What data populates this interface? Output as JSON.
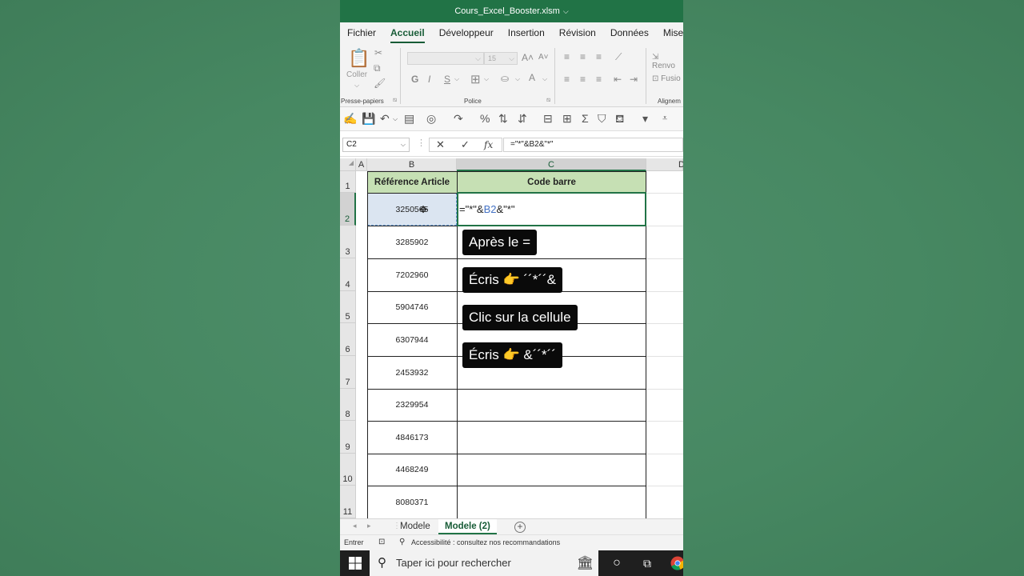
{
  "window": {
    "title": "Cours_Excel_Booster.xlsm"
  },
  "menu": {
    "tabs": [
      "Fichier",
      "Accueil",
      "Développeur",
      "Insertion",
      "Révision",
      "Données",
      "Mise en"
    ]
  },
  "ribbon": {
    "paste_label": "Coller",
    "font_size": "15",
    "bold": "G",
    "italic": "I",
    "underline": "S",
    "groups": {
      "clipboard": "Presse-papiers",
      "font": "Police",
      "alignment": "Alignem"
    },
    "wrap_label": "Renvo",
    "merge_label": "Fusio"
  },
  "formula_bar": {
    "name_box": "C2",
    "cancel": "✕",
    "enter": "✓",
    "fx": "fx",
    "formula": "=\"*\"&B2&\"*\""
  },
  "grid": {
    "columns": [
      "A",
      "B",
      "C",
      "D"
    ],
    "rows": [
      "1",
      "2",
      "3",
      "4",
      "5",
      "6",
      "7",
      "8",
      "9",
      "10",
      "11"
    ],
    "header_b": "Référence Article",
    "header_c": "Code barre",
    "b_values": [
      "3250565",
      "3285902",
      "7202960",
      "5904746",
      "6307944",
      "2453932",
      "2329954",
      "4846173",
      "4468249",
      "8080371"
    ],
    "c2_parts": {
      "p1": "=\"*\"&",
      "ref": "B2",
      "p2": "&\"*\""
    }
  },
  "callouts": {
    "c1": "Après le =",
    "c2": "Écris 👉 ´´*´´&",
    "c3": "Clic sur la cellule",
    "c4": "Écris 👉 &´´*´´"
  },
  "sheets": {
    "tab1": "Modele",
    "tab2": "Modele (2)"
  },
  "status": {
    "mode": "Entrer",
    "accessibility": "Accessibilité : consultez nos recommandations"
  },
  "taskbar": {
    "search_placeholder": "Taper ici pour rechercher"
  },
  "colors": {
    "excel_green": "#217346",
    "header_fill": "#c6e0b4",
    "selected_ref": "#4472c4"
  }
}
